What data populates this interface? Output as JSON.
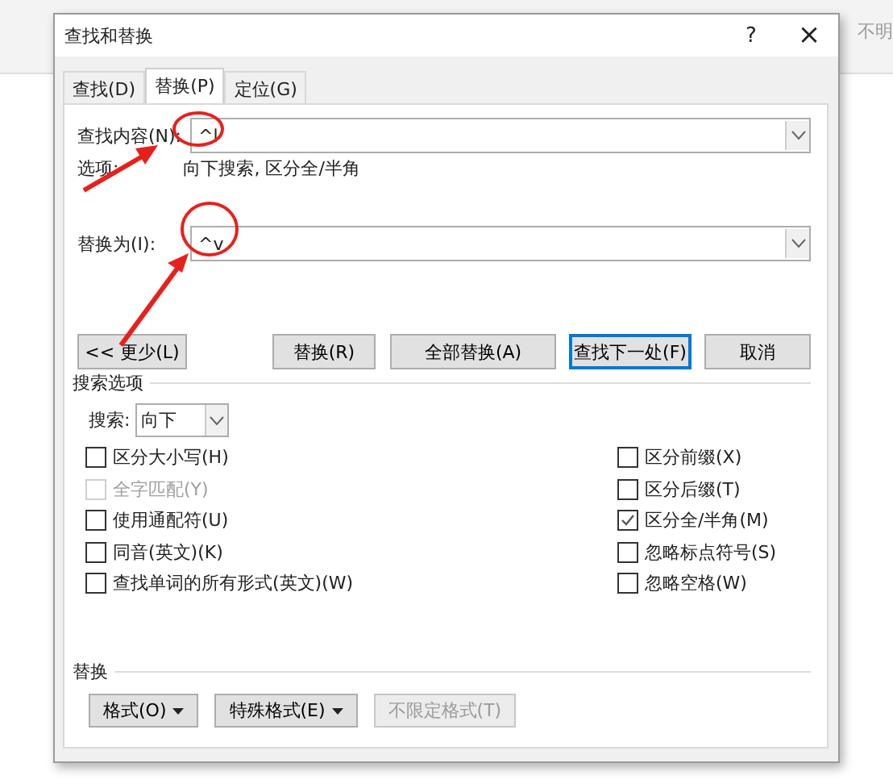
{
  "background": {
    "ribbon_text": "不明"
  },
  "window": {
    "title": "查找和替换",
    "help": "?",
    "close": "×"
  },
  "tabs": [
    {
      "label": "查找(D)",
      "selected": false
    },
    {
      "label": "替换(P)",
      "selected": true
    },
    {
      "label": "定位(G)",
      "selected": false
    }
  ],
  "find": {
    "label": "查找内容(N):",
    "value": "^l",
    "options_label": "选项:",
    "options_value": "向下搜索, 区分全/半角"
  },
  "replace": {
    "label": "替换为(I):",
    "value": "^v"
  },
  "buttons": [
    {
      "label": "<< 更少(L)",
      "focused": false
    },
    {
      "label": "替换(R)",
      "focused": false
    },
    {
      "label": "全部替换(A)",
      "focused": false
    },
    {
      "label": "查找下一处(F)",
      "focused": true
    },
    {
      "label": "取消",
      "focused": false
    }
  ],
  "search_options": {
    "heading": "搜索选项",
    "direction_label": "搜索:",
    "direction_value": "向下",
    "left": [
      {
        "label": "区分大小写(H)",
        "checked": false,
        "disabled": false
      },
      {
        "label": "全字匹配(Y)",
        "checked": false,
        "disabled": true
      },
      {
        "label": "使用通配符(U)",
        "checked": false,
        "disabled": false
      },
      {
        "label": "同音(英文)(K)",
        "checked": false,
        "disabled": false
      },
      {
        "label": "查找单词的所有形式(英文)(W)",
        "checked": false,
        "disabled": false
      }
    ],
    "right": [
      {
        "label": "区分前缀(X)",
        "checked": false,
        "disabled": false
      },
      {
        "label": "区分后缀(T)",
        "checked": false,
        "disabled": false
      },
      {
        "label": "区分全/半角(M)",
        "checked": true,
        "disabled": false
      },
      {
        "label": "忽略标点符号(S)",
        "checked": false,
        "disabled": false
      },
      {
        "label": "忽略空格(W)",
        "checked": false,
        "disabled": false
      }
    ]
  },
  "replace_section": {
    "heading": "替换",
    "buttons": [
      {
        "label": "格式(O)",
        "dropdown": true,
        "disabled": false
      },
      {
        "label": "特殊格式(E)",
        "dropdown": true,
        "disabled": false
      },
      {
        "label": "不限定格式(T)",
        "dropdown": false,
        "disabled": true
      }
    ]
  }
}
